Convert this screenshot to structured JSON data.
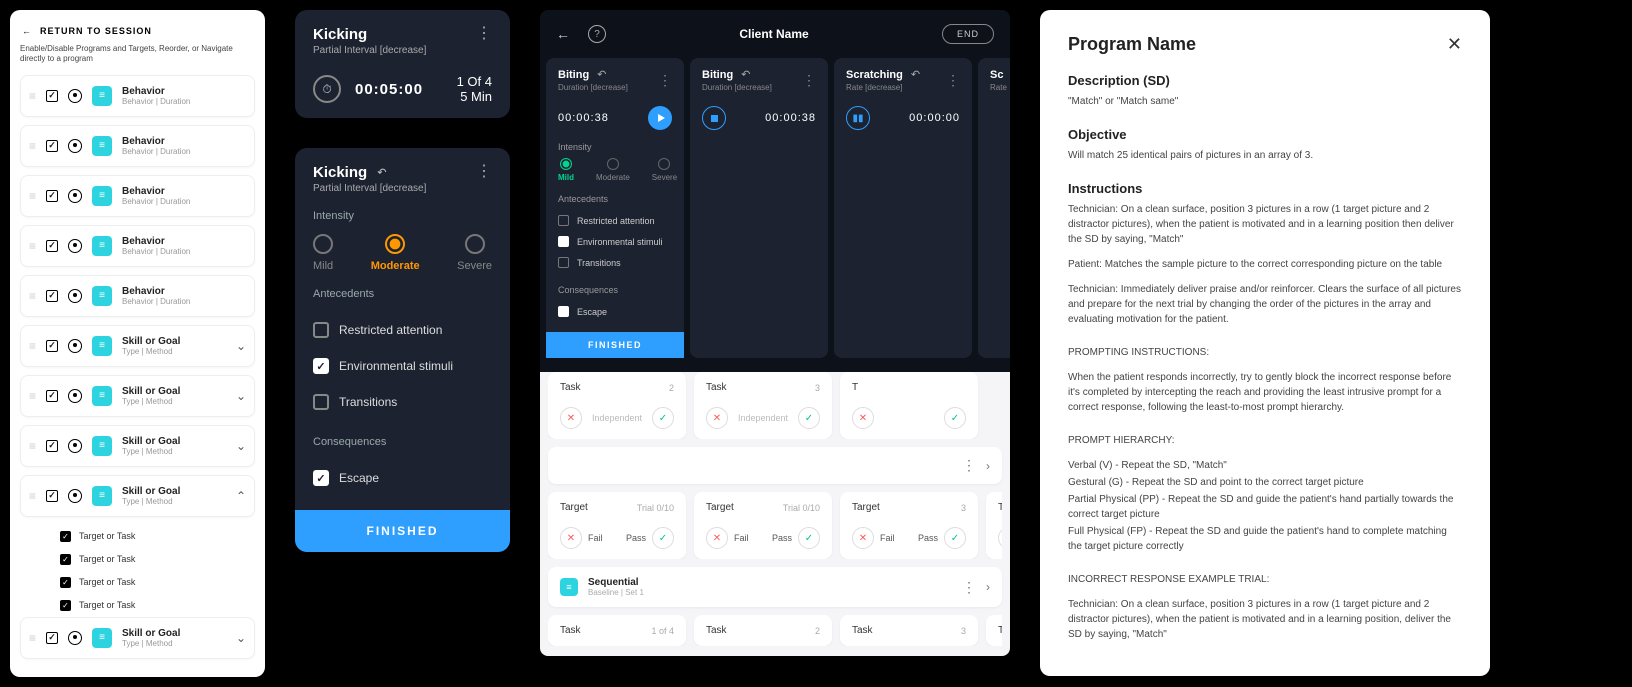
{
  "panel1": {
    "return_label": "RETURN TO SESSION",
    "caption": "Enable/Disable Programs and Targets, Reorder, or Navigate directly to a program",
    "behaviors": [
      {
        "title": "Behavior",
        "sub": "Behavior | Duration"
      },
      {
        "title": "Behavior",
        "sub": "Behavior | Duration"
      },
      {
        "title": "Behavior",
        "sub": "Behavior | Duration"
      },
      {
        "title": "Behavior",
        "sub": "Behavior | Duration"
      },
      {
        "title": "Behavior",
        "sub": "Behavior | Duration"
      }
    ],
    "skills": [
      {
        "title": "Skill or Goal",
        "sub": "Type | Method",
        "open": false
      },
      {
        "title": "Skill or Goal",
        "sub": "Type | Method",
        "open": false
      },
      {
        "title": "Skill or Goal",
        "sub": "Type | Method",
        "open": false
      },
      {
        "title": "Skill or Goal",
        "sub": "Type | Method",
        "open": true,
        "children": [
          "Target or Task",
          "Target or Task",
          "Target or Task",
          "Target or Task"
        ]
      },
      {
        "title": "Skill or Goal",
        "sub": "Type | Method",
        "open": false
      }
    ]
  },
  "panel2": {
    "card1": {
      "title": "Kicking",
      "sub": "Partial Interval [decrease]",
      "timer": "00:05:00",
      "count1": "1 Of 4",
      "count2": "5 Min"
    },
    "card2": {
      "title": "Kicking",
      "sub": "Partial Interval [decrease]",
      "intensity_label": "Intensity",
      "options": [
        "Mild",
        "Moderate",
        "Severe"
      ],
      "selected": 1,
      "antecedents_label": "Antecedents",
      "antecedents": [
        {
          "label": "Restricted attention",
          "checked": false
        },
        {
          "label": "Environmental stimuli",
          "checked": true
        },
        {
          "label": "Transitions",
          "checked": false
        }
      ],
      "consequences_label": "Consequences",
      "consequences": [
        {
          "label": "Escape",
          "checked": true
        }
      ],
      "finished": "FINISHED"
    }
  },
  "panel3": {
    "client": "Client Name",
    "end": "END",
    "behaviors": [
      {
        "title": "Biting",
        "sub": "Duration [decrease]",
        "time": "00:00:38",
        "controls": "play",
        "expanded": true,
        "intensity_label": "Intensity",
        "int_options": [
          "Mild",
          "Moderate",
          "Severe"
        ],
        "int_sel": 0,
        "ant_label": "Antecedents",
        "ants": [
          {
            "l": "Restricted attention",
            "c": false
          },
          {
            "l": "Environmental stimuli",
            "c": true
          },
          {
            "l": "Transitions",
            "c": false
          }
        ],
        "cons_label": "Consequences",
        "cons": [
          {
            "l": "Escape",
            "c": true
          }
        ],
        "finished": "FINISHED"
      },
      {
        "title": "Biting",
        "sub": "Duration [decrease]",
        "time": "00:00:38",
        "controls": "stop"
      },
      {
        "title": "Scratching",
        "sub": "Rate [decrease]",
        "time": "00:00:00",
        "controls": "chart"
      },
      {
        "title": "Sc",
        "sub": "Rate",
        "time": "",
        "controls": ""
      }
    ],
    "rows": [
      {
        "type": "tasks",
        "items": [
          {
            "title": "Task",
            "count": "2",
            "left": "",
            "mid": "Independent",
            "right": ""
          },
          {
            "title": "Task",
            "count": "3",
            "left": "",
            "mid": "Independent",
            "right": ""
          },
          {
            "title": "T",
            "count": "",
            "left": "",
            "mid": "",
            "right": ""
          }
        ]
      },
      {
        "type": "seq",
        "badge": "≡"
      },
      {
        "type": "targets",
        "items": [
          {
            "title": "Target",
            "count": "Trial 0/10",
            "fail": "Fail",
            "pass": "Pass"
          },
          {
            "title": "Target",
            "count": "Trial 0/10",
            "fail": "Fail",
            "pass": "Pass"
          },
          {
            "title": "Target",
            "count": "3",
            "fail": "Fail",
            "pass": "Pass"
          },
          {
            "title": "T",
            "count": "",
            "fail": "",
            "pass": ""
          }
        ]
      },
      {
        "type": "seq2",
        "title": "Sequential",
        "sub": "Baseline | Set 1",
        "badge": "≡"
      },
      {
        "type": "tasks2",
        "items": [
          {
            "title": "Task",
            "count": "1 of 4"
          },
          {
            "title": "Task",
            "count": "2"
          },
          {
            "title": "Task",
            "count": "3"
          },
          {
            "title": "T",
            "count": ""
          }
        ]
      }
    ]
  },
  "panel4": {
    "title": "Program Name",
    "desc_h": "Description (SD)",
    "desc_p": "\"Match\" or \"Match same\"",
    "obj_h": "Objective",
    "obj_p": "Will match 25 identical pairs of pictures in an array of 3.",
    "inst_h": "Instructions",
    "inst1": "Technician: On a clean surface, position 3 pictures in a row (1 target picture and 2 distractor pictures), when the patient is motivated and in a learning position then deliver the SD by saying, \"Match\"",
    "inst2": "Patient: Matches the sample picture to the correct corresponding picture on the table",
    "inst3": "Technician: Immediately deliver praise and/or reinforcer. Clears the surface of all pictures and prepare for the next trial by changing the order of the pictures in the array and evaluating motivation for the patient.",
    "prompt_h": "PROMPTING INSTRUCTIONS:",
    "prompt_p": "When the patient responds incorrectly, try to gently block the incorrect response before it's completed by intercepting the reach and providing the least intrusive prompt for a correct response, following the least-to-most prompt hierarchy.",
    "hier_h": "PROMPT HIERARCHY:",
    "hier1": "Verbal (V) - Repeat the SD, \"Match\"",
    "hier2": "Gestural (G) - Repeat the SD and point to the correct target picture",
    "hier3": "Partial Physical (PP) - Repeat the SD and guide the patient's hand partially towards the correct target picture",
    "hier4": "Full Physical (FP) - Repeat the SD and guide the patient's hand to complete matching the target picture correctly",
    "incor_h": "INCORRECT RESPONSE EXAMPLE TRIAL:",
    "incor_p": "Technician: On a clean surface, position 3 pictures in a row (1 target picture and 2 distractor pictures), when the patient is motivated and in a learning position, deliver the SD by saying, \"Match\""
  }
}
